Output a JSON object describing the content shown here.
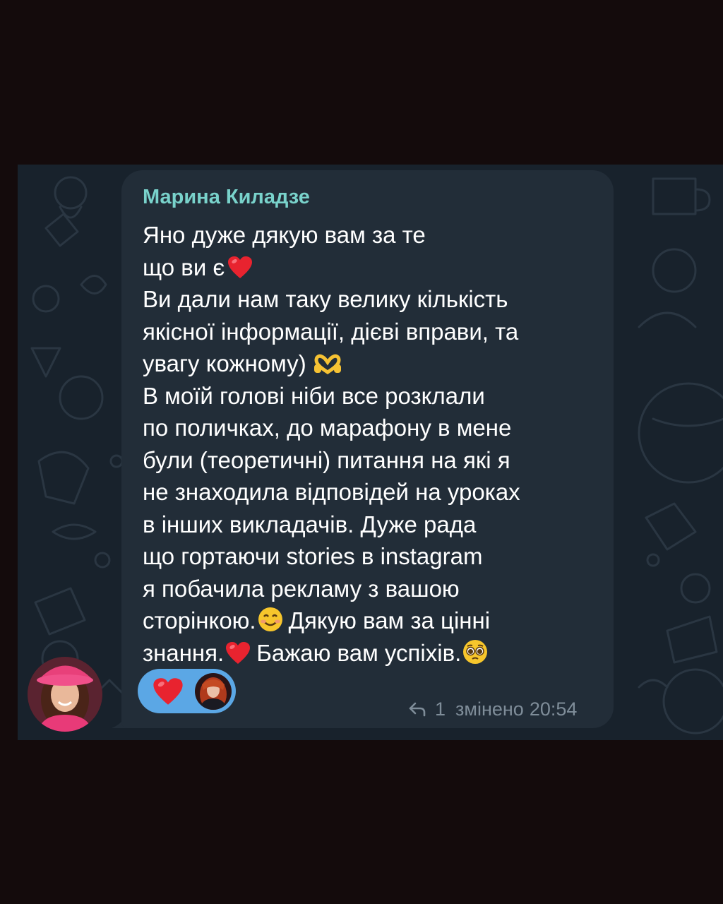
{
  "message": {
    "sender": "Марина Киладзе",
    "lines": [
      "Яно дуже дякую вам за те",
      "що ви є",
      "Ви дали нам таку велику кількість",
      "якісної інформації,  дієві вправи, та",
      "увагу кожному)",
      "В моїй голові ніби все розклали",
      "по поличках, до марафону в мене",
      "були (теоретичні) питання на які я",
      "не знаходила відповідей на уроках",
      "в інших викладачів. Дуже рада",
      "що гортаючи stories в instagram",
      "я побачила рекламу з вашою",
      "сторінкою.",
      "Дякую вам за цінні",
      "знання.",
      "Бажаю вам успіхів."
    ],
    "emojis": [
      "red-heart",
      "heart-hands",
      "smiling-face",
      "red-heart",
      "pleading-face"
    ],
    "reaction": "red-heart",
    "reply_count": "1",
    "edited_label": "змінено",
    "time": "20:54"
  },
  "colors": {
    "page_background": "#140b0c",
    "chat_background": "#18222c",
    "bubble": "#222d38",
    "sender_name": "#79d2cb",
    "text": "#ffffff",
    "meta_text": "#7f8d99",
    "reaction_pill": "#5ba7e5"
  }
}
